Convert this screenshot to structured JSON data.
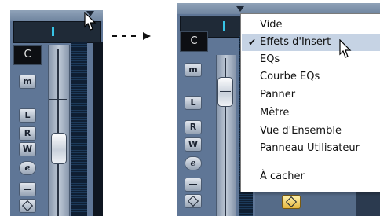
{
  "left_strip": {
    "channel_label": "C",
    "buttons": {
      "monitor": "m",
      "listen": "L",
      "read": "R",
      "write": "W",
      "edit": "e"
    }
  },
  "right_strip": {
    "channel_label": "C",
    "buttons": {
      "monitor": "m",
      "listen": "L",
      "read": "R",
      "write": "W",
      "edit": "e"
    }
  },
  "context_menu": {
    "items": [
      {
        "label": "Vide",
        "checked": false,
        "highlighted": false
      },
      {
        "label": "Effets d'Insert",
        "checked": true,
        "highlighted": true
      },
      {
        "label": "EQs",
        "checked": false,
        "highlighted": false
      },
      {
        "label": "Courbe EQs",
        "checked": false,
        "highlighted": false
      },
      {
        "label": "Panner",
        "checked": false,
        "highlighted": false
      },
      {
        "label": "Mètre",
        "checked": false,
        "highlighted": false
      },
      {
        "label": "Vue d'Ensemble",
        "checked": false,
        "highlighted": false
      },
      {
        "label": "Panneau Utilisateur",
        "checked": false,
        "highlighted": false
      }
    ],
    "hide_item": {
      "label": "À cacher"
    },
    "check_glyph": "✔"
  },
  "colors": {
    "strip": "#5f7696",
    "menu_highlight": "#c6d3e4",
    "meter_tick": "#37c4e6"
  }
}
